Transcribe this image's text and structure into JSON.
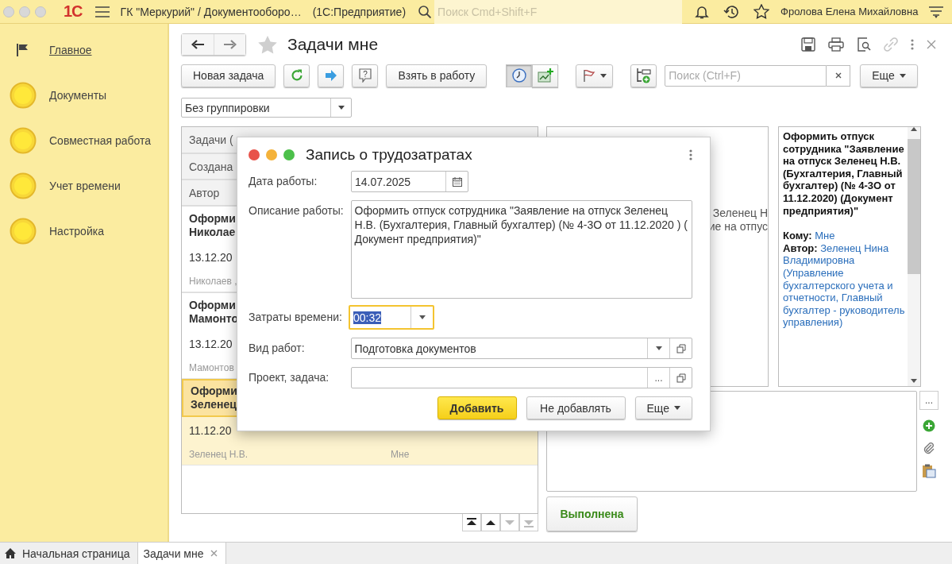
{
  "app_bar": {
    "logo": "1С",
    "title": "ГК \"Меркурий\" / Документооборо…",
    "subtitle": "(1С:Предприятие)",
    "search": {
      "placeholder": "Поиск Cmd+Shift+F"
    },
    "user": "Фролова Елена Михайловна"
  },
  "sidebar": {
    "items": [
      {
        "label": "Главное",
        "kind": "flag",
        "selected": true
      },
      {
        "label": "Документы",
        "kind": "section",
        "selected": false
      },
      {
        "label": "Совместная работа",
        "kind": "section",
        "selected": false
      },
      {
        "label": "Учет времени",
        "kind": "section",
        "selected": false
      },
      {
        "label": "Настройка",
        "kind": "section",
        "selected": false
      }
    ]
  },
  "form": {
    "title": "Задачи мне",
    "favorite": false,
    "toolbar": [
      {
        "kind": "text",
        "label": "Новая задача"
      },
      {
        "kind": "refresh"
      },
      {
        "kind": "forward"
      },
      {
        "kind": "help",
        "glyph": "?"
      },
      {
        "kind": "text",
        "label": "Взять в работу"
      },
      {
        "kind": "clock",
        "pressed": true
      },
      {
        "kind": "chart",
        "pressed": false
      },
      {
        "kind": "flag_menu"
      },
      {
        "kind": "tree_add"
      },
      {
        "kind": "search",
        "placeholder": "Поиск (Ctrl+F)"
      },
      {
        "kind": "menu",
        "label": "Еще"
      }
    ],
    "grouping": "Без группировки"
  },
  "task_list": {
    "header": "Задачи (",
    "header_rows": [
      "Создана",
      "Автор"
    ],
    "rows": [
      {
        "title_lines": [
          "Оформи",
          "Николае"
        ],
        "date": "13.12.20",
        "author": "Николаев ,",
        "selected": false
      },
      {
        "title_lines": [
          "Оформи",
          "Мамонто"
        ],
        "date": "13.12.20",
        "author": "Мамонтов",
        "selected": false
      },
      {
        "title_lines": [
          "Оформи",
          "Зеленец"
        ],
        "date": "11.12.20",
        "author": "Зеленец Н.В.",
        "recipient": "Мне",
        "selected": true
      }
    ],
    "nav": [
      {
        "kind": "first",
        "disabled": false
      },
      {
        "kind": "prev",
        "disabled": false
      },
      {
        "kind": "next",
        "disabled": true
      },
      {
        "kind": "last",
        "disabled": true
      }
    ]
  },
  "preview": {
    "fragments": [
      "Зеленец Н",
      "ие на отпус"
    ]
  },
  "details": {
    "title": "Оформить отпуск сотрудника \"Заявление на отпуск Зеленец Н.В. (Бухгалтерия, Главный бухгалтер) (№ 4-3О от 11.12.2020) (Документ предприятия)\"",
    "to": "**Кому:** Мне",
    "author": "**Автор:** Зеленец Нина Владимировна (Управление бухгалтерского учета и отчетности, Главный бухгалтер - руководитель управления)"
  },
  "comments": {
    "more": "..."
  },
  "complete_button": "Выполнена",
  "dialog": {
    "title": "Запись о трудозатратах",
    "fields": [
      {
        "kind": "date",
        "label": "Дата работы:",
        "value": "14.07.2025"
      },
      {
        "kind": "textarea",
        "label": "Описание работы:",
        "value": "Оформить отпуск сотрудника \"Заявление на отпуск Зеленец Н.В. (Бухгалтерия, Главный бухгалтер) (№ 4-3О от 11.12.2020 ) (                 Документ предприятия)\""
      },
      {
        "kind": "duration",
        "label": "Затраты времени:",
        "value": "00:32",
        "focused": true
      },
      {
        "kind": "select",
        "label": "Вид работ:",
        "value": "Подготовка документов"
      },
      {
        "kind": "choice",
        "label": "Проект, задача:",
        "button": "..."
      }
    ],
    "buttons": [
      {
        "kind": "default",
        "label": "Добавить"
      },
      {
        "kind": "plain",
        "label": "Не добавлять"
      },
      {
        "kind": "menu",
        "label": "Еще"
      }
    ]
  },
  "tabs": [
    {
      "kind": "home",
      "label": "Начальная страница",
      "selected": false
    },
    {
      "kind": "closable",
      "label": "Задачи мне",
      "selected": true
    }
  ]
}
